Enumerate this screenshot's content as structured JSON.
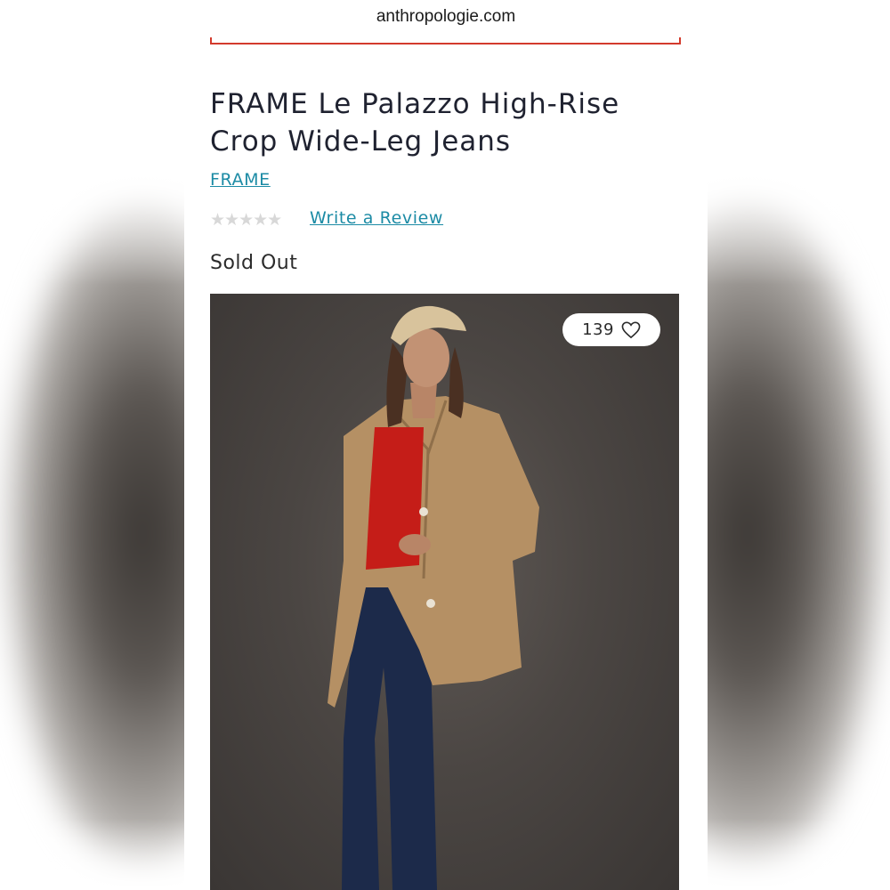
{
  "browser": {
    "url": "anthropologie.com"
  },
  "product": {
    "title": "FRAME Le Palazzo High-Rise Crop Wide-Leg Jeans",
    "brand": "FRAME",
    "rating_stars": "★★★★★",
    "review_link": "Write a Review",
    "status": "Sold Out"
  },
  "gallery": {
    "favorites_count": "139",
    "favorite_icon": "heart-icon"
  },
  "colors": {
    "link": "#1c8ba5",
    "progress_line": "#d33a2c",
    "photo_background": "#4b4643"
  }
}
